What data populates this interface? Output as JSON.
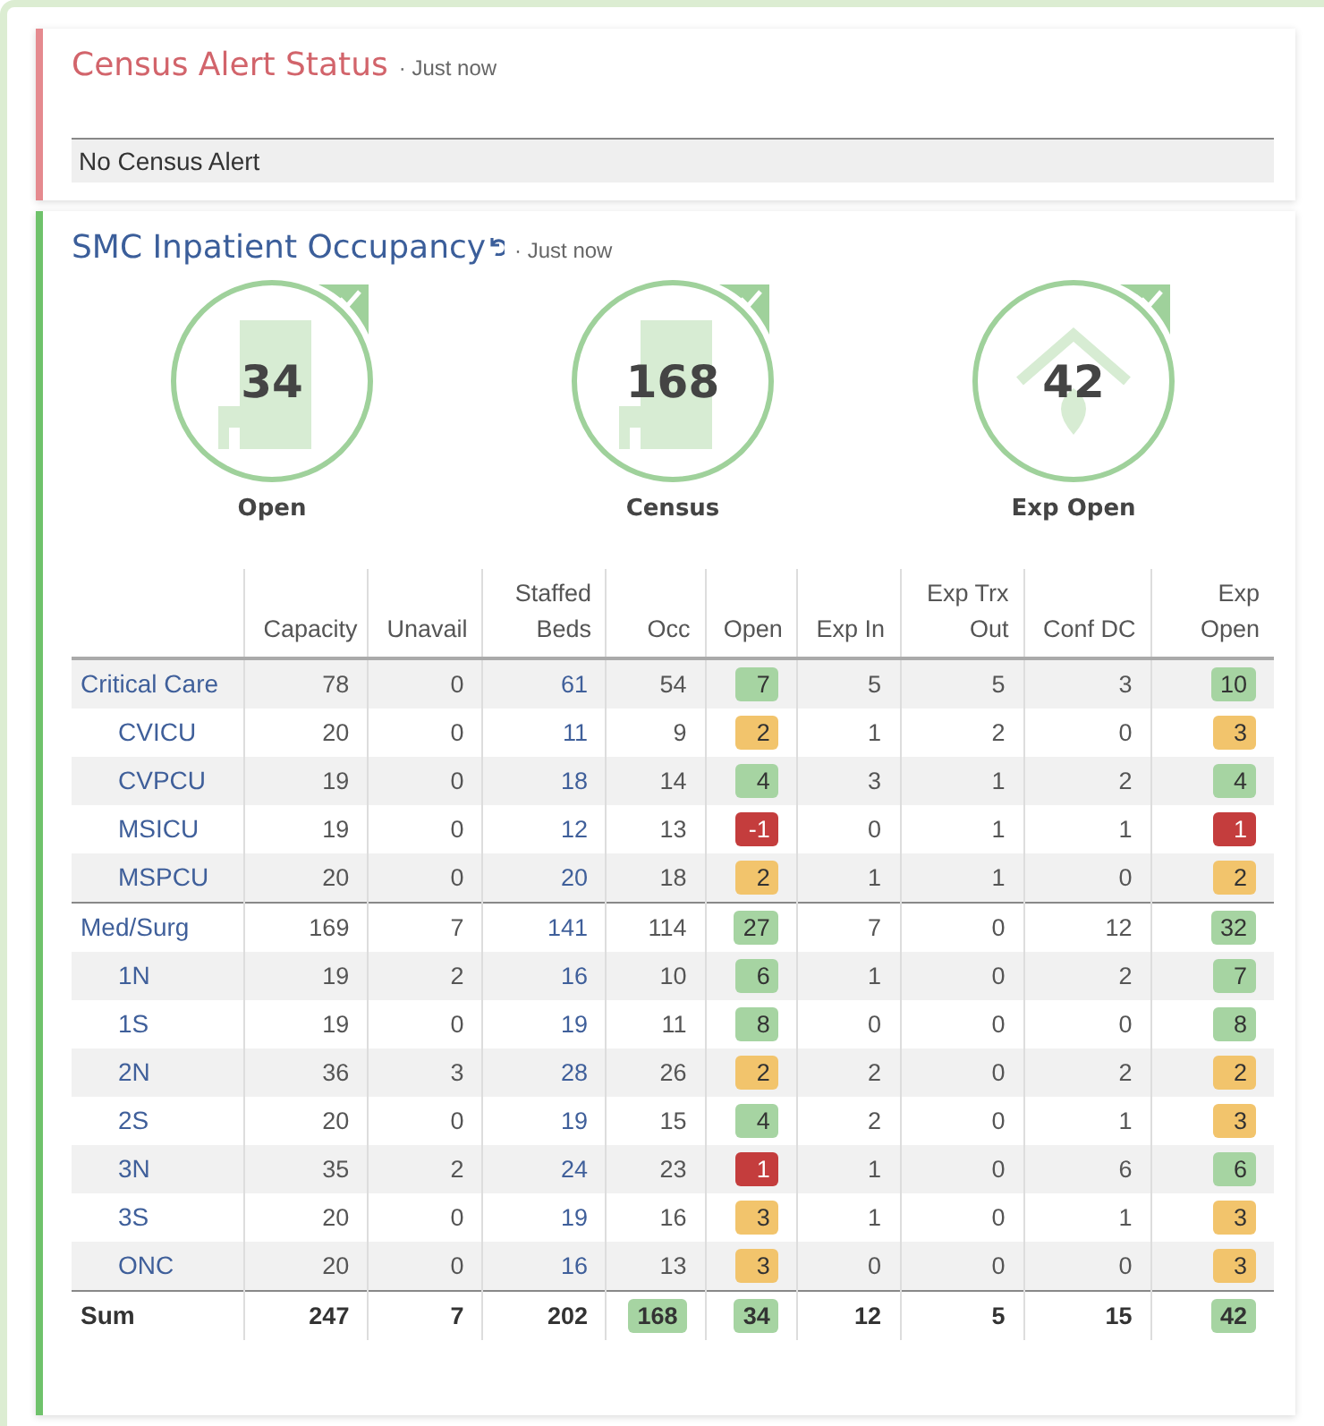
{
  "alert_card": {
    "title": "Census Alert Status",
    "updated": "· Just now",
    "message": "No Census Alert"
  },
  "occupancy_card": {
    "title": "SMC Inpatient Occupancy",
    "updated": "· Just now",
    "kpis": [
      {
        "value": "34",
        "label": "Open",
        "kind": "hospital",
        "checked": true
      },
      {
        "value": "168",
        "label": "Census",
        "kind": "hospital",
        "checked": true
      },
      {
        "value": "42",
        "label": "Exp Open",
        "kind": "home",
        "checked": true
      }
    ],
    "table": {
      "columns": [
        "Capacity",
        "Unavail",
        "Staffed Beds",
        "Occ",
        "Open",
        "Exp In",
        "Exp Trx Out",
        "Conf DC",
        "Exp Open"
      ],
      "rows": [
        {
          "name": "Critical Care",
          "cells": [
            "78",
            "0",
            "61",
            "54",
            {
              "value": "7",
              "color": "#a6d4a2"
            },
            "5",
            "5",
            "3",
            {
              "value": "10",
              "color": "#a6d4a2"
            }
          ],
          "children": [
            {
              "name": "CVICU",
              "cells": [
                "20",
                "0",
                "11",
                "9",
                {
                  "value": "2",
                  "color": "#f2c46c"
                },
                "1",
                "2",
                "0",
                {
                  "value": "3",
                  "color": "#f2c46c"
                }
              ]
            },
            {
              "name": "CVPCU",
              "cells": [
                "19",
                "0",
                "18",
                "14",
                {
                  "value": "4",
                  "color": "#a6d4a2"
                },
                "3",
                "1",
                "2",
                {
                  "value": "4",
                  "color": "#a6d4a2"
                }
              ]
            },
            {
              "name": "MSICU",
              "cells": [
                "19",
                "0",
                "12",
                "13",
                {
                  "value": "-1",
                  "color": "#c43d3d"
                },
                "0",
                "1",
                "1",
                {
                  "value": "1",
                  "color": "#c43d3d"
                }
              ]
            },
            {
              "name": "MSPCU",
              "cells": [
                "20",
                "0",
                "20",
                "18",
                {
                  "value": "2",
                  "color": "#f2c46c"
                },
                "1",
                "1",
                "0",
                {
                  "value": "2",
                  "color": "#f2c46c"
                }
              ]
            }
          ]
        },
        {
          "name": "Med/Surg",
          "cells": [
            "169",
            "7",
            "141",
            "114",
            {
              "value": "27",
              "color": "#a6d4a2"
            },
            "7",
            "0",
            "12",
            {
              "value": "32",
              "color": "#a6d4a2"
            }
          ],
          "children": [
            {
              "name": "1N",
              "cells": [
                "19",
                "2",
                "16",
                "10",
                {
                  "value": "6",
                  "color": "#a6d4a2"
                },
                "1",
                "0",
                "2",
                {
                  "value": "7",
                  "color": "#a6d4a2"
                }
              ]
            },
            {
              "name": "1S",
              "cells": [
                "19",
                "0",
                "19",
                "11",
                {
                  "value": "8",
                  "color": "#a6d4a2"
                },
                "0",
                "0",
                "0",
                {
                  "value": "8",
                  "color": "#a6d4a2"
                }
              ]
            },
            {
              "name": "2N",
              "cells": [
                "36",
                "3",
                "28",
                "26",
                {
                  "value": "2",
                  "color": "#f2c46c"
                },
                "2",
                "0",
                "2",
                {
                  "value": "2",
                  "color": "#f2c46c"
                }
              ]
            },
            {
              "name": "2S",
              "cells": [
                "20",
                "0",
                "19",
                "15",
                {
                  "value": "4",
                  "color": "#a6d4a2"
                },
                "2",
                "0",
                "1",
                {
                  "value": "3",
                  "color": "#f2c46c"
                }
              ]
            },
            {
              "name": "3N",
              "cells": [
                "35",
                "2",
                "24",
                "23",
                {
                  "value": "1",
                  "color": "#c43d3d"
                },
                "1",
                "0",
                "6",
                {
                  "value": "6",
                  "color": "#a6d4a2"
                }
              ]
            },
            {
              "name": "3S",
              "cells": [
                "20",
                "0",
                "19",
                "16",
                {
                  "value": "3",
                  "color": "#f2c46c"
                },
                "1",
                "0",
                "1",
                {
                  "value": "3",
                  "color": "#f2c46c"
                }
              ]
            },
            {
              "name": "ONC",
              "cells": [
                "20",
                "0",
                "16",
                "13",
                {
                  "value": "3",
                  "color": "#f2c46c"
                },
                "0",
                "0",
                "0",
                {
                  "value": "3",
                  "color": "#f2c46c"
                }
              ]
            }
          ]
        }
      ],
      "total": {
        "name": "Sum",
        "cells": [
          "247",
          "7",
          "202",
          {
            "value": "168",
            "color": "#a6d4a2"
          },
          {
            "value": "34",
            "color": "#a6d4a2"
          },
          "12",
          "5",
          "15",
          {
            "value": "42",
            "color": "#a6d4a2"
          }
        ]
      }
    }
  }
}
